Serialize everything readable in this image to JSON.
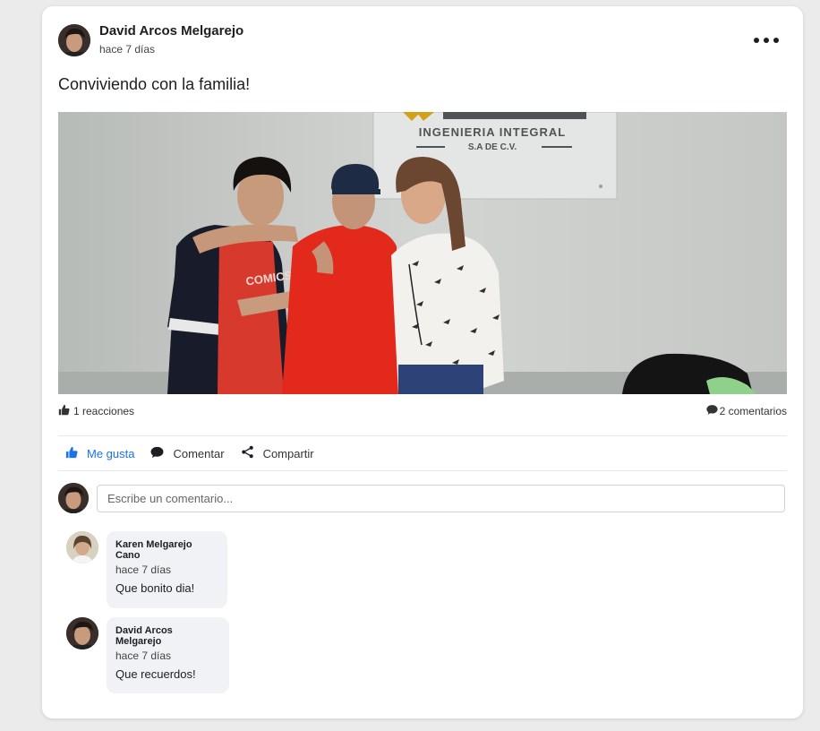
{
  "post": {
    "author": "David Arcos Melgarejo",
    "time": "hace 7 días",
    "text": "Conviviendo con la familia!",
    "photo_sign": {
      "line1": "INGENIERIA INTEGRAL",
      "line2": "S.A DE C.V."
    },
    "shirt_print": "COMICS"
  },
  "stats": {
    "reactions": "1 reacciones",
    "comments": "2 comentarios"
  },
  "actions": {
    "like": "Me gusta",
    "comment": "Comentar",
    "share": "Compartir"
  },
  "comment_box": {
    "placeholder": "Escribe un comentario..."
  },
  "comments": [
    {
      "name": "Karen Melgarejo Cano",
      "time": "hace 7 días",
      "text": "Que bonito dia!"
    },
    {
      "name": "David Arcos Melgarejo",
      "time": "hace 7 días",
      "text": "Que recuerdos!"
    }
  ],
  "colors": {
    "accent": "#1a73e8",
    "card": "#ffffff",
    "background": "#ebebeb",
    "bubble": "#f0f2f5"
  },
  "icons": [
    "more-options-icon",
    "thumbs-up-icon",
    "comment-bubble-icon",
    "share-icon"
  ]
}
